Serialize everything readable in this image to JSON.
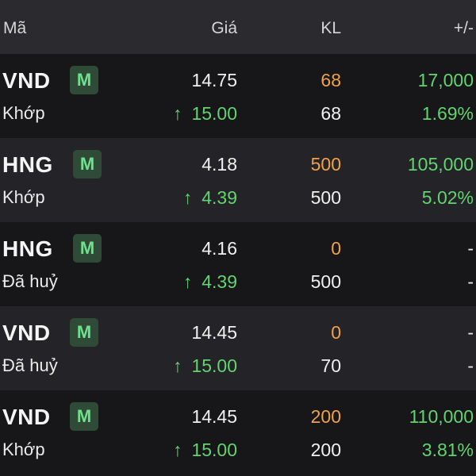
{
  "header": {
    "symbol": "Mã",
    "price": "Giá",
    "volume": "KL",
    "change": "+/-"
  },
  "rows": [
    {
      "symbol": "VND",
      "badge": "M",
      "status": "Khớp",
      "price": "14.75",
      "arrow": "↑",
      "match_price": "15.00",
      "order_vol": "68",
      "match_vol": "68",
      "change": "17,000",
      "pct": "1.69%"
    },
    {
      "symbol": "HNG",
      "badge": "M",
      "status": "Khớp",
      "price": "4.18",
      "arrow": "↑",
      "match_price": "4.39",
      "order_vol": "500",
      "match_vol": "500",
      "change": "105,000",
      "pct": "5.02%"
    },
    {
      "symbol": "HNG",
      "badge": "M",
      "status": "Đã huỷ",
      "price": "4.16",
      "arrow": "↑",
      "match_price": "4.39",
      "order_vol": "0",
      "match_vol": "500",
      "change": "-",
      "pct": "-"
    },
    {
      "symbol": "VND",
      "badge": "M",
      "status": "Đã huỷ",
      "price": "14.45",
      "arrow": "↑",
      "match_price": "15.00",
      "order_vol": "0",
      "match_vol": "70",
      "change": "-",
      "pct": "-"
    },
    {
      "symbol": "VND",
      "badge": "M",
      "status": "Khớp",
      "price": "14.45",
      "arrow": "↑",
      "match_price": "15.00",
      "order_vol": "200",
      "match_vol": "200",
      "change": "110,000",
      "pct": "3.81%"
    }
  ],
  "colors": {
    "up": "#62d46f",
    "volume_order": "#f0a14a",
    "badge_bg": "#2f4a37",
    "badge_fg": "#6fe08c"
  }
}
